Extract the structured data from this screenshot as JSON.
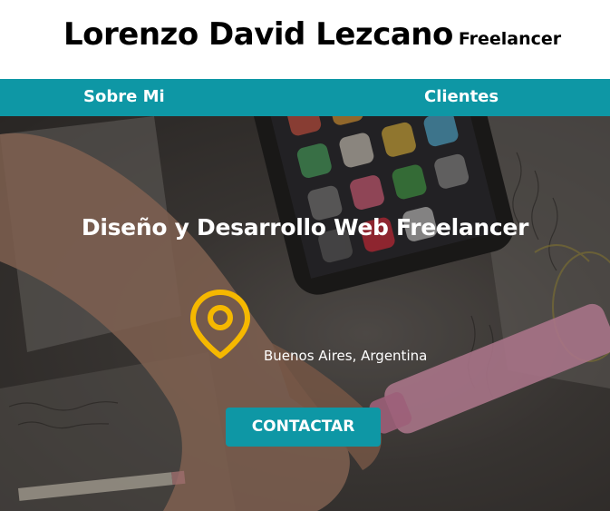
{
  "header": {
    "name": "Lorenzo David Lezcano",
    "role": "Freelancer"
  },
  "nav": {
    "items": [
      {
        "label": "Sobre Mi"
      },
      {
        "label": "Clientes"
      }
    ]
  },
  "hero": {
    "headline": "Diseño y Desarrollo Web Freelancer",
    "location": "Buenos Aires, Argentina",
    "location_icon": "map-pin-icon",
    "cta_label": "CONTACTAR"
  },
  "colors": {
    "accent": "#0e97a5",
    "pin": "#f5b800",
    "highlighter": "#f7a8c8"
  }
}
